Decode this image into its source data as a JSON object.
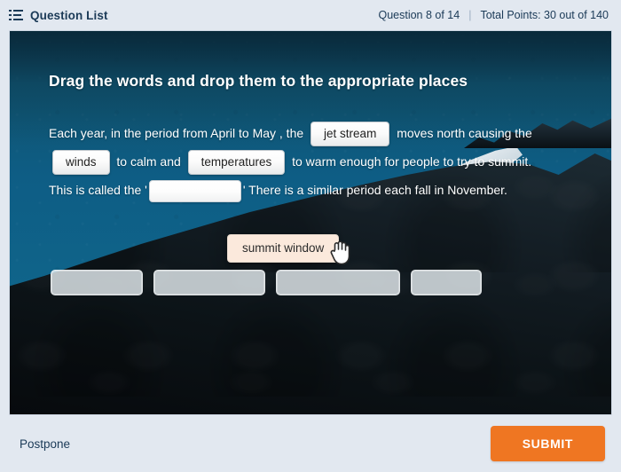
{
  "header": {
    "list_icon": "list-icon",
    "title": "Question List",
    "question_counter": "Question 8 of 14",
    "separator": "|",
    "points": "Total Points: 30 out of 140"
  },
  "question": {
    "title": "Drag the words and drop them to the appropriate places",
    "segments": [
      {
        "type": "text",
        "value": "Each year, in the period from April to May , the "
      },
      {
        "type": "chip",
        "value": "jet stream"
      },
      {
        "type": "text",
        "value": " moves north causing the "
      },
      {
        "type": "chip",
        "value": "winds"
      },
      {
        "type": "text",
        "value": " to calm and "
      },
      {
        "type": "chip",
        "value": "temperatures"
      },
      {
        "type": "text",
        "value": " to warm enough for people to try to summit. This is called the '"
      },
      {
        "type": "blank",
        "value": ""
      },
      {
        "type": "text",
        "value": "' There is a similar period each fall in November."
      }
    ],
    "text_1": "Each year, in the period from April to May , the",
    "chip_1": "jet stream",
    "text_2": "moves north causing the",
    "chip_2": "winds",
    "text_3": "to calm and",
    "chip_3": "temperatures",
    "text_4": "to warm enough for people to try to summit. This is called the '",
    "text_5": "' There is a similar period each fall in November."
  },
  "drag": {
    "label": "summit window",
    "cursor": "grabbing-hand-cursor"
  },
  "word_bank": {
    "slots": [
      {
        "label": ""
      },
      {
        "label": ""
      },
      {
        "label": ""
      },
      {
        "label": ""
      }
    ]
  },
  "footer": {
    "postpone_label": "Postpone",
    "submit_label": "SUBMIT"
  },
  "colors": {
    "chrome": "#e2e8f0",
    "text_dark": "#1b3a57",
    "stage_sky": "#0e5a82",
    "accent_submit": "#ef7622",
    "drag_chip_bg": "#fbe9dc",
    "chip_bg": "#ffffff"
  }
}
